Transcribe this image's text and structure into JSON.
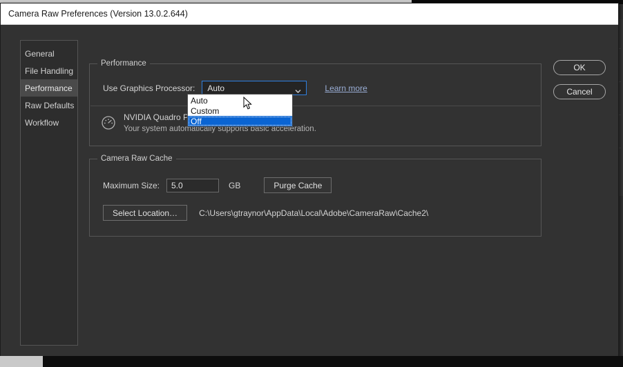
{
  "window": {
    "title": "Camera Raw Preferences  (Version 13.0.2.644)"
  },
  "sidebar": {
    "items": [
      {
        "label": "General",
        "selected": false
      },
      {
        "label": "File Handling",
        "selected": false
      },
      {
        "label": "Performance",
        "selected": true
      },
      {
        "label": "Raw Defaults",
        "selected": false
      },
      {
        "label": "Workflow",
        "selected": false
      }
    ]
  },
  "performance": {
    "group_title": "Performance",
    "gpu_label": "Use Graphics Processor:",
    "gpu_selected": "Auto",
    "gpu_options": [
      "Auto",
      "Custom",
      "Off"
    ],
    "gpu_highlighted_option": "Off",
    "learn_more": "Learn more",
    "gpu_name": "NVIDIA Quadro P620",
    "gpu_description": "Your system automatically supports basic acceleration.",
    "gauge_icon": "gauge-icon",
    "chevron_icon": "chevron-down-icon"
  },
  "cache": {
    "group_title": "Camera Raw Cache",
    "max_size_label": "Maximum Size:",
    "max_size_value": "5.0",
    "unit": "GB",
    "purge_button": "Purge Cache",
    "select_location_button": "Select Location…",
    "path": "C:\\Users\\gtraynor\\AppData\\Local\\Adobe\\CameraRaw\\Cache2\\"
  },
  "actions": {
    "ok": "OK",
    "cancel": "Cancel"
  },
  "colors": {
    "dialog_bg": "#323232",
    "titlebar_bg": "#ffffff",
    "accent_blue": "#0a64d2",
    "focus_border": "#2e7fe0",
    "link": "#9aaed6",
    "nav_selected": "#4a4a4a"
  },
  "toolbar": {
    "glyphs": [
      "↗",
      "⬤",
      "◰",
      "⬡",
      "✐",
      "✦",
      "◢",
      "■",
      "⌗",
      "▬",
      "▲"
    ]
  }
}
